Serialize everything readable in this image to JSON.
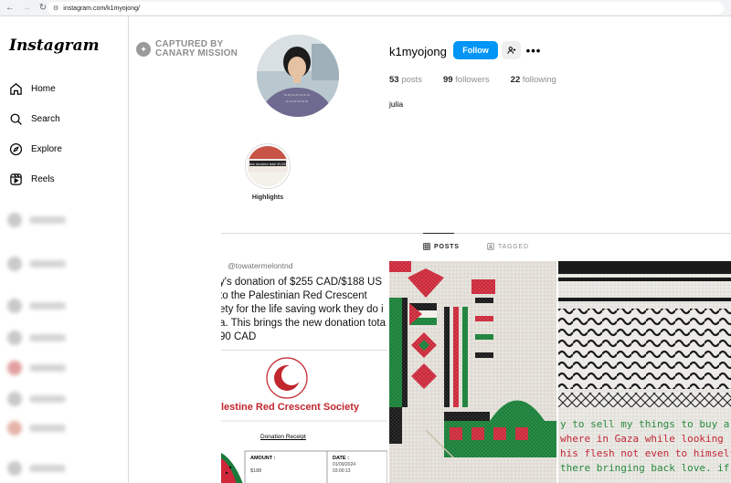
{
  "browser": {
    "url": "instagram.com/k1myojong/"
  },
  "sidebar": {
    "logo": "Instagram",
    "items": [
      {
        "label": "Home",
        "icon": "home-icon"
      },
      {
        "label": "Search",
        "icon": "search-icon"
      },
      {
        "label": "Explore",
        "icon": "explore-icon"
      },
      {
        "label": "Reels",
        "icon": "reels-icon"
      }
    ]
  },
  "watermark": {
    "line1": "CAPTURED BY",
    "line2": "CANARY MISSION"
  },
  "profile": {
    "username": "k1myojong",
    "follow_label": "Follow",
    "more_label": "•••",
    "posts_count": "53",
    "posts_label": "posts",
    "followers_count": "99",
    "followers_label": "followers",
    "following_count": "22",
    "following_label": "following",
    "full_name": "julia"
  },
  "highlights": [
    {
      "label": "Highlights",
      "cover_text": "New donation total $5,000"
    }
  ],
  "tabs": [
    {
      "label": "POSTS",
      "active": true
    },
    {
      "label": "TAGGED",
      "active": false
    }
  ],
  "posts": [
    {
      "handle": "@towatermelontnd",
      "lines": [
        "y's donation of $255 CAD/$188 US",
        "to the Palestinian Red Crescent",
        "ety for the life saving work they do i",
        "a. This brings the new donation tota",
        "90 CAD"
      ],
      "receipt_org": "lestine Red Crescent Society",
      "receipt_title": "Donation Receipt",
      "amount_label": "AMOUNT :",
      "amount_value": "$188",
      "date_label": "DATE :",
      "date_value": "01/09/2024",
      "time_value": "03:00:13"
    },
    {
      "caption": "keffiyeh cross-stitch"
    },
    {
      "stitch_lines": [
        "y to sell my things to buy a",
        "where in Gaza while looking",
        "his flesh not even to himself",
        "there bringing back love. if I"
      ]
    }
  ],
  "colors": {
    "accent": "#0095f6",
    "border": "#dbdbdb",
    "muted": "#8e8e8e",
    "red": "#c1272d",
    "green": "#1b7a3b"
  }
}
